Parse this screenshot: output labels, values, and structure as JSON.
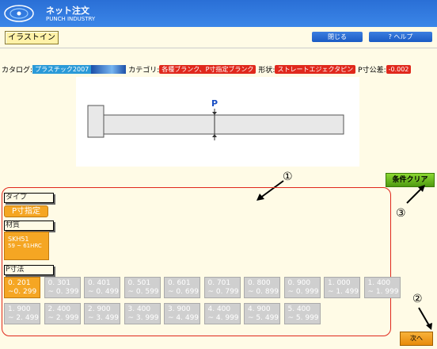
{
  "header": {
    "logo_line1": "ネット注文",
    "logo_line2": "PUNCH INDUSTRY"
  },
  "toolbar": {
    "illust_label": "イラストイン",
    "close_label": "閉じる",
    "help_label": "? ヘルプ"
  },
  "info": {
    "catalog_label": "カタログ:",
    "catalog_value": "プラスチック2007",
    "category_label": "カテゴリ:",
    "category_value": "各種ブランク、P寸指定ブランク",
    "shape_label": "形状:",
    "shape_value": "ストレートエジェクタピン",
    "tol_label": "P寸公差:",
    "tol_value": "-0.002"
  },
  "drawing": {
    "p_label": "P"
  },
  "condition_clear": "条件クリア",
  "annotations": {
    "a1": "①",
    "a2": "②",
    "a3": "③"
  },
  "type_section": {
    "label": "タイプ",
    "selected": "P寸指定"
  },
  "material_section": {
    "label": "材質",
    "name": "SKH51",
    "spec": "59 ~ 61HRC"
  },
  "p_section": {
    "label": "P寸法",
    "ranges": [
      {
        "l1": "0. 201",
        "l2": "~0. 299",
        "selected": true
      },
      {
        "l1": "0. 301",
        "l2": "~ 0. 399",
        "selected": false
      },
      {
        "l1": "0. 401",
        "l2": "~ 0. 499",
        "selected": false
      },
      {
        "l1": "0. 501",
        "l2": "~ 0. 599",
        "selected": false
      },
      {
        "l1": "0. 601",
        "l2": "~ 0. 699",
        "selected": false
      },
      {
        "l1": "0. 701",
        "l2": "~ 0. 799",
        "selected": false
      },
      {
        "l1": "0. 800",
        "l2": "~ 0. 899",
        "selected": false
      },
      {
        "l1": "0. 900",
        "l2": "~ 0. 999",
        "selected": false
      },
      {
        "l1": "1. 000",
        "l2": "~ 1. 499",
        "selected": false
      },
      {
        "l1": "1. 400",
        "l2": "~ 1. 999",
        "selected": false
      },
      {
        "l1": "1. 900",
        "l2": "~ 2. 499",
        "selected": false
      },
      {
        "l1": "2. 400",
        "l2": "~ 2. 999",
        "selected": false
      },
      {
        "l1": "2. 900",
        "l2": "~ 3. 499",
        "selected": false
      },
      {
        "l1": "3. 400",
        "l2": "~ 3. 999",
        "selected": false
      },
      {
        "l1": "3. 900",
        "l2": "~ 4. 499",
        "selected": false
      },
      {
        "l1": "4. 400",
        "l2": "~ 4. 999",
        "selected": false
      },
      {
        "l1": "4. 900",
        "l2": "~ 5. 499",
        "selected": false
      },
      {
        "l1": "5. 400",
        "l2": "~ 5. 999",
        "selected": false
      }
    ]
  },
  "next_label": "次へ"
}
